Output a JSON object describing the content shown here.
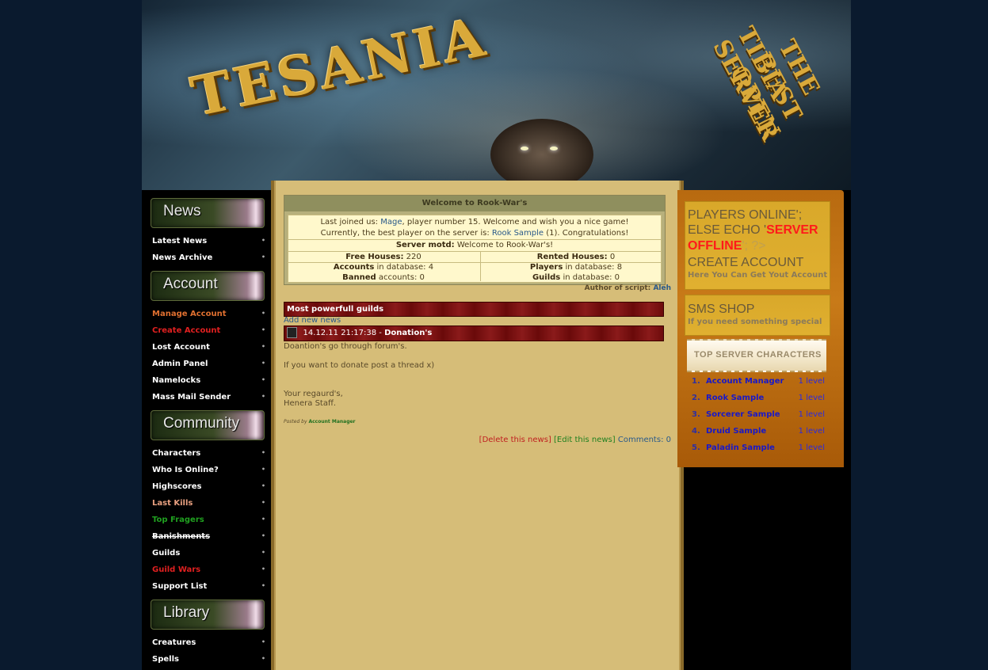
{
  "banner": {
    "logo": "TESANIA",
    "slogan_line1": "THE BEST OPEN",
    "slogan_line2": "TIBIA SERVER"
  },
  "menu": {
    "news": {
      "title": "News",
      "items": [
        {
          "label": "Latest News"
        },
        {
          "label": "News Archive"
        }
      ]
    },
    "account": {
      "title": "Account",
      "items": [
        {
          "label": "Manage Account",
          "color": "#e07030"
        },
        {
          "label": "Create Account",
          "color": "#e02020"
        },
        {
          "label": "Lost Account"
        },
        {
          "label": "Admin Panel"
        },
        {
          "label": "Namelocks"
        },
        {
          "label": "Mass Mail Sender"
        }
      ]
    },
    "community": {
      "title": "Community",
      "items": [
        {
          "label": "Characters"
        },
        {
          "label": "Who Is Online?"
        },
        {
          "label": "Highscores"
        },
        {
          "label": "Last Kills",
          "color": "#e8a080"
        },
        {
          "label": "Top Fragers",
          "color": "#20a020"
        },
        {
          "label": "Banishments",
          "style": "strikethrough"
        },
        {
          "label": "Guilds"
        },
        {
          "label": "Guild Wars",
          "color": "#e02020"
        },
        {
          "label": "Support List"
        }
      ]
    },
    "library": {
      "title": "Library",
      "items": [
        {
          "label": "Creatures"
        },
        {
          "label": "Spells"
        }
      ]
    }
  },
  "welcome": {
    "title": "Welcome to Rook-War's",
    "last_joined_prefix": "Last joined us:",
    "last_joined_name": "Mage",
    "last_joined_suffix": ", player number 15. Welcome and wish you a nice game!",
    "best_player_prefix": "Currently, the best player on the server is:",
    "best_player_name": "Rook Sample",
    "best_player_suffix": "(1). Congratulations!",
    "motd_label": "Server motd:",
    "motd_text": "Welcome to Rook-War's!",
    "free_houses_label": "Free Houses:",
    "free_houses_value": "220",
    "rented_houses_label": "Rented Houses:",
    "rented_houses_value": "0",
    "accounts_label": "Accounts",
    "accounts_suffix": "in database: 4",
    "players_label": "Players",
    "players_suffix": "in database: 8",
    "banned_label": "Banned",
    "banned_suffix": "accounts: 0",
    "guilds_label": "Guilds",
    "guilds_suffix": "in database: 0",
    "author_prefix": "Author of script:",
    "author_name": "Aleh"
  },
  "guilds_bar": "Most powerfull guilds",
  "news": {
    "add_link": "Add new news",
    "date": "14.12.11 21:17:38",
    "separator": " - ",
    "title": "Donation's",
    "line1": "Doantion's go through forum's.",
    "line2": "If you want to donate post a thread x)",
    "line3": "Your regaurd's,",
    "line4": "Henera Staff.",
    "posted_by_label": "Posted by",
    "posted_by_name": "Account Manager",
    "delete_link": "[Delete this news]",
    "edit_link": "[Edit this news]",
    "comments_label": "Comments:",
    "comments_count": "0"
  },
  "sidebar": {
    "online_line1": "PLAYERS ONLINE';",
    "online_line2": "ELSE ECHO '",
    "server_offline_1": "SERVER",
    "server_offline_2": "OFFLINE",
    "online_tail": "'; ?>",
    "create_account_title": "CREATE ACCOUNT",
    "create_account_sub": "Here You Can Get Yout Account",
    "sms_title": "SMS SHOP",
    "sms_sub": "If you need something special",
    "top_chars_title": "TOP SERVER CHARACTERS",
    "top_chars": [
      {
        "rank": "1.",
        "name": "Account Manager",
        "level": "1 level"
      },
      {
        "rank": "2.",
        "name": "Rook Sample",
        "level": "1 level"
      },
      {
        "rank": "3.",
        "name": "Sorcerer Sample",
        "level": "1 level"
      },
      {
        "rank": "4.",
        "name": "Druid Sample",
        "level": "1 level"
      },
      {
        "rank": "5.",
        "name": "Paladin Sample",
        "level": "1 level"
      }
    ]
  },
  "colors": {
    "page_bg": "#0a1a2e",
    "content_bg": "#d6bd78",
    "sidebar_bg": "#c87a18",
    "offline_red": "#ff1a1a",
    "link_blue": "#2a5a8a"
  }
}
